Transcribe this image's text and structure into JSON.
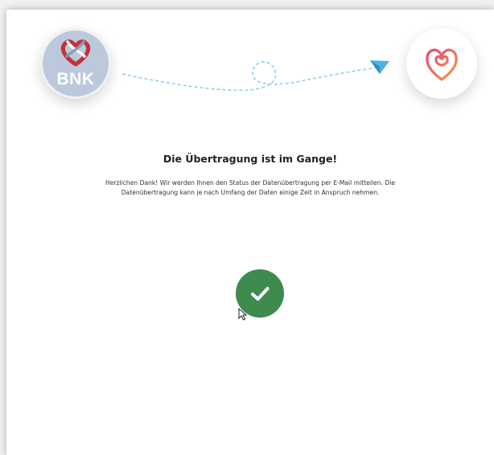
{
  "header": {
    "left_logo_icon": "bnk-logo-icon",
    "left_logo_text": "BNK",
    "right_logo_icon": "heart-logo-icon",
    "path_icon": "paper-plane-icon"
  },
  "content": {
    "title": "Die Übertragung ist im Gange!",
    "message_line1": "Herzlichen Dank! Wir werden Ihnen den Status der Datenübertragung per E-Mail mitteilen. Die",
    "message_line2": "Datenübertragung kann je nach Umfang der Daten einige Zeit in Anspruch nehmen."
  },
  "status": {
    "icon": "check-icon",
    "color": "#3d8b4d"
  },
  "colors": {
    "accent_blue": "#4fb3e0",
    "bnk_bg": "#bcc9dd",
    "bnk_red": "#c5303a",
    "heart_gradient_start": "#e8457a",
    "heart_gradient_end": "#f59a3c"
  }
}
